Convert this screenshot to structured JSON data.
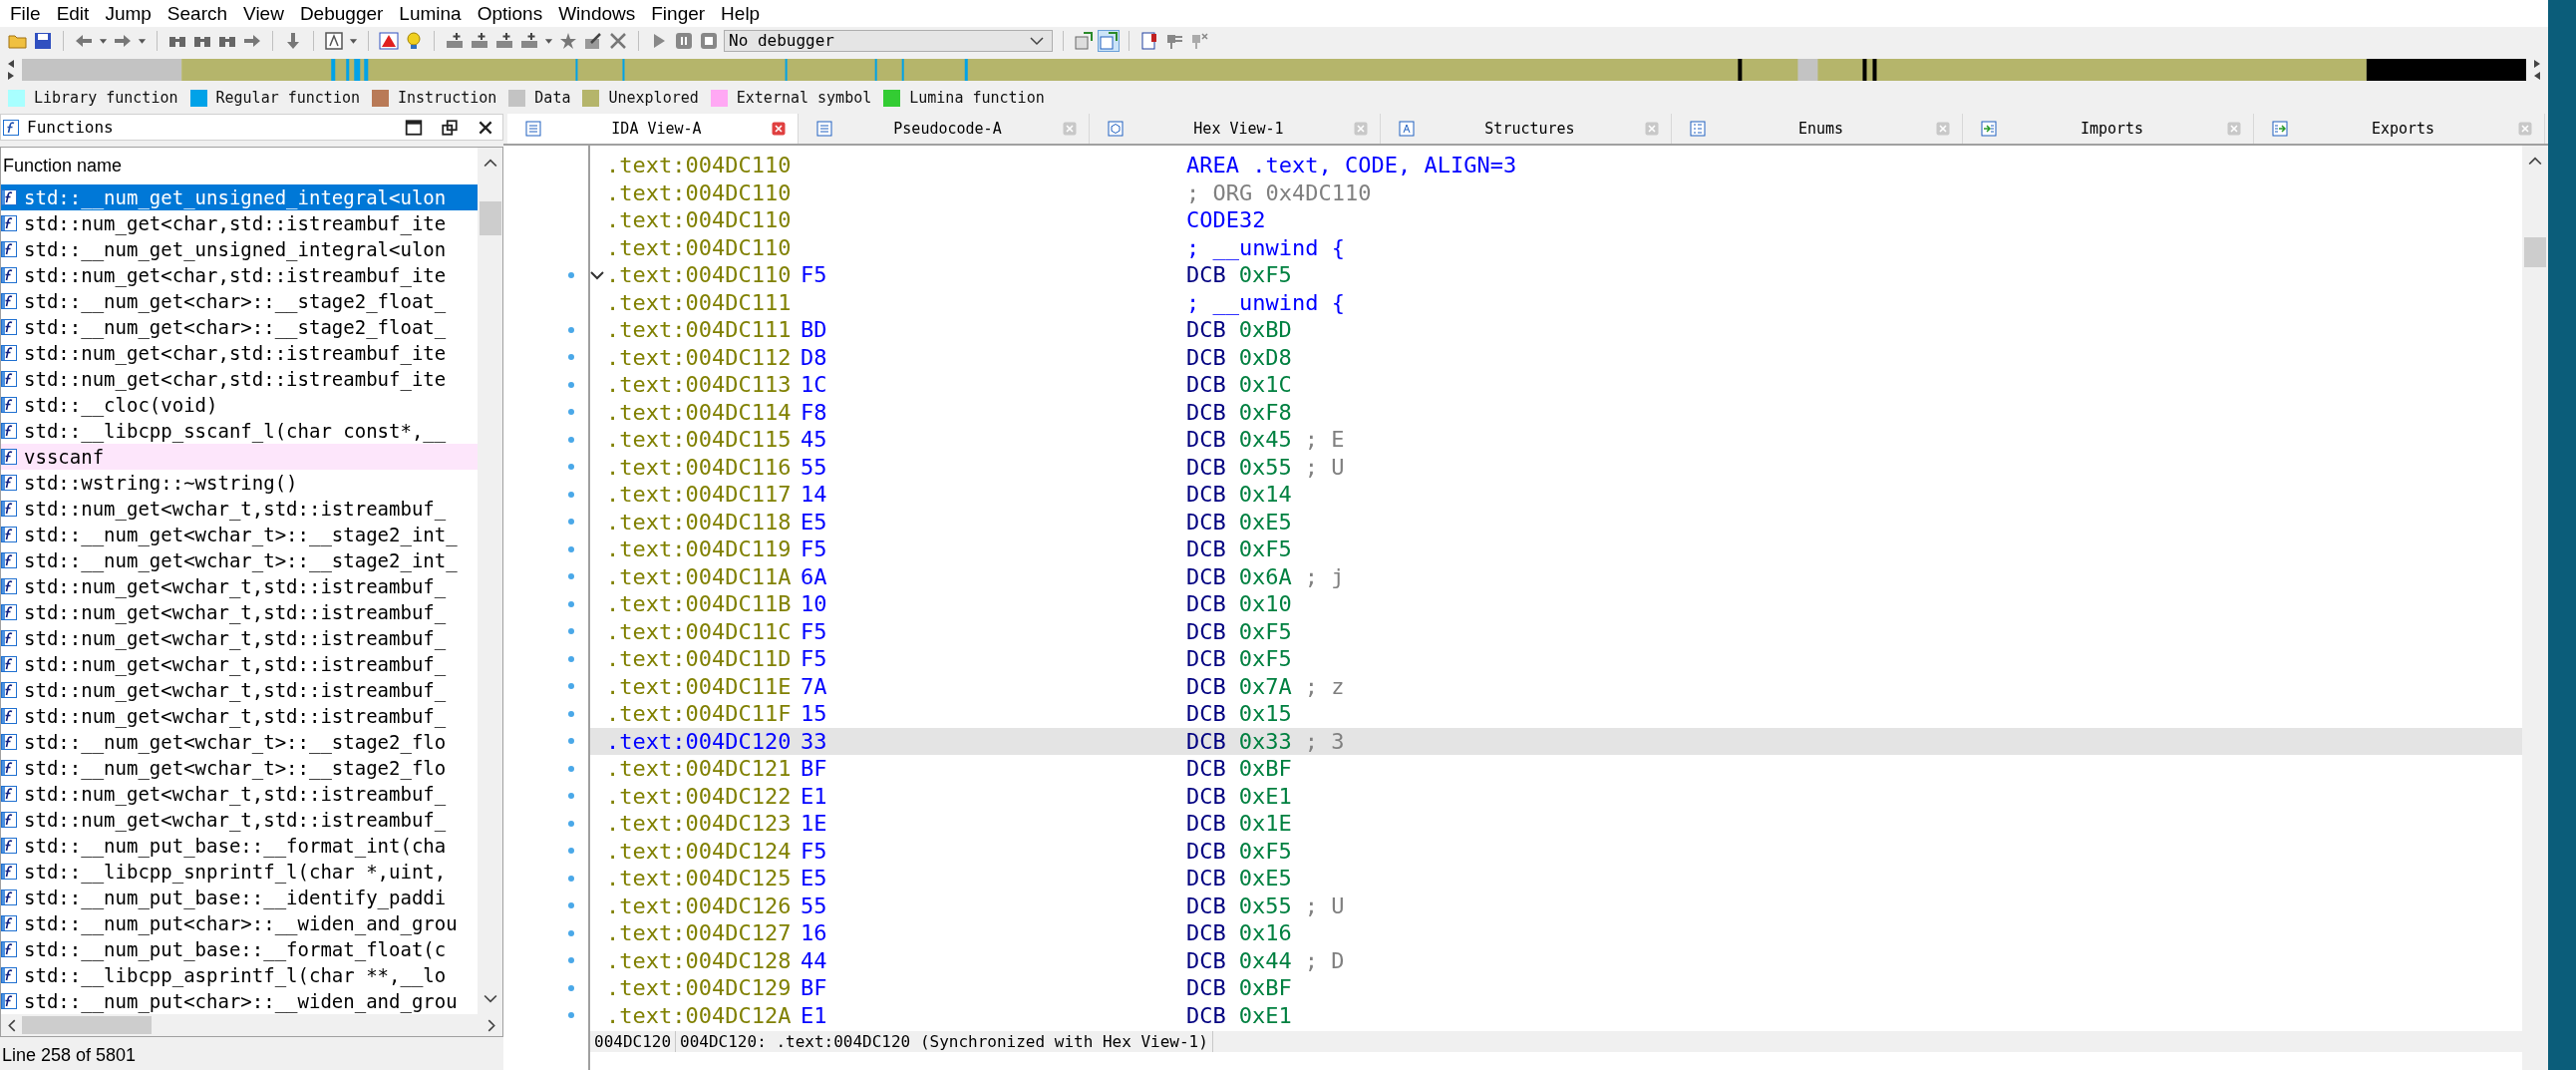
{
  "menu": [
    "File",
    "Edit",
    "Jump",
    "Search",
    "View",
    "Debugger",
    "Lumina",
    "Options",
    "Windows",
    "Finger",
    "Help"
  ],
  "toolbar": {
    "debugger": "No debugger"
  },
  "legend": [
    {
      "label": "Library function",
      "color": "#a8ffff"
    },
    {
      "label": "Regular function",
      "color": "#00a2e8"
    },
    {
      "label": "Instruction",
      "color": "#b97a57"
    },
    {
      "label": "Data",
      "color": "#c3c3c3"
    },
    {
      "label": "Unexplored",
      "color": "#b5b56b"
    },
    {
      "label": "External symbol",
      "color": "#ffa8f4"
    },
    {
      "label": "Lumina function",
      "color": "#33cc33"
    }
  ],
  "functions": {
    "title": "Functions",
    "column": "Function name",
    "status": "Line 258 of 5801",
    "rows": [
      {
        "name": "std::__num_get_unsigned_integral<ulon",
        "selected": true,
        "kind": "regular"
      },
      {
        "name": "std::num_get<char,std::istreambuf_ite",
        "selected": false,
        "kind": "regular"
      },
      {
        "name": "std::__num_get_unsigned_integral<ulon",
        "selected": false,
        "kind": "regular"
      },
      {
        "name": "std::num_get<char,std::istreambuf_ite",
        "selected": false,
        "kind": "regular"
      },
      {
        "name": "std::__num_get<char>::__stage2_float_",
        "selected": false,
        "kind": "regular"
      },
      {
        "name": "std::__num_get<char>::__stage2_float_",
        "selected": false,
        "kind": "regular"
      },
      {
        "name": "std::num_get<char,std::istreambuf_ite",
        "selected": false,
        "kind": "regular"
      },
      {
        "name": "std::num_get<char,std::istreambuf_ite",
        "selected": false,
        "kind": "regular"
      },
      {
        "name": "std::__cloc(void)",
        "selected": false,
        "kind": "regular"
      },
      {
        "name": "std::__libcpp_sscanf_l(char const*,__",
        "selected": false,
        "kind": "regular"
      },
      {
        "name": "vsscanf",
        "selected": false,
        "kind": "external"
      },
      {
        "name": "std::wstring::~wstring()",
        "selected": false,
        "kind": "regular"
      },
      {
        "name": "std::num_get<wchar_t,std::istreambuf_",
        "selected": false,
        "kind": "regular"
      },
      {
        "name": "std::__num_get<wchar_t>::__stage2_int_",
        "selected": false,
        "kind": "regular"
      },
      {
        "name": "std::__num_get<wchar_t>::__stage2_int_",
        "selected": false,
        "kind": "regular"
      },
      {
        "name": "std::num_get<wchar_t,std::istreambuf_",
        "selected": false,
        "kind": "regular"
      },
      {
        "name": "std::num_get<wchar_t,std::istreambuf_",
        "selected": false,
        "kind": "regular"
      },
      {
        "name": "std::num_get<wchar_t,std::istreambuf_",
        "selected": false,
        "kind": "regular"
      },
      {
        "name": "std::num_get<wchar_t,std::istreambuf_",
        "selected": false,
        "kind": "regular"
      },
      {
        "name": "std::num_get<wchar_t,std::istreambuf_",
        "selected": false,
        "kind": "regular"
      },
      {
        "name": "std::num_get<wchar_t,std::istreambuf_",
        "selected": false,
        "kind": "regular"
      },
      {
        "name": "std::__num_get<wchar_t>::__stage2_flo",
        "selected": false,
        "kind": "regular"
      },
      {
        "name": "std::__num_get<wchar_t>::__stage2_flo",
        "selected": false,
        "kind": "regular"
      },
      {
        "name": "std::num_get<wchar_t,std::istreambuf_",
        "selected": false,
        "kind": "regular"
      },
      {
        "name": "std::num_get<wchar_t,std::istreambuf_",
        "selected": false,
        "kind": "regular"
      },
      {
        "name": "std::__num_put_base::__format_int(cha",
        "selected": false,
        "kind": "regular"
      },
      {
        "name": "std::__libcpp_snprintf_l(char *,uint,",
        "selected": false,
        "kind": "regular"
      },
      {
        "name": "std::__num_put_base::__identify_paddi",
        "selected": false,
        "kind": "regular"
      },
      {
        "name": "std::__num_put<char>::__widen_and_grou",
        "selected": false,
        "kind": "regular"
      },
      {
        "name": "std::__num_put_base::__format_float(c",
        "selected": false,
        "kind": "regular"
      },
      {
        "name": "std::__libcpp_asprintf_l(char **,__lo",
        "selected": false,
        "kind": "regular"
      },
      {
        "name": "std::__num_put<char>::__widen_and_grou",
        "selected": false,
        "kind": "regular"
      }
    ]
  },
  "tabs": [
    {
      "label": "IDA View-A",
      "selected": true,
      "kind": "listing"
    },
    {
      "label": "Pseudocode-A",
      "selected": false,
      "kind": "listing"
    },
    {
      "label": "Hex View-1",
      "selected": false,
      "kind": "hex"
    },
    {
      "label": "Structures",
      "selected": false,
      "kind": "struct"
    },
    {
      "label": "Enums",
      "selected": false,
      "kind": "enum"
    },
    {
      "label": "Imports",
      "selected": false,
      "kind": "import"
    },
    {
      "label": "Exports",
      "selected": false,
      "kind": "export"
    }
  ],
  "listing": {
    "rows": [
      {
        "address": ".text:004DC110",
        "kind": "directive",
        "text": "AREA .text, CODE, ALIGN=3",
        "marker": false,
        "fold": false,
        "selected": false
      },
      {
        "address": ".text:004DC110",
        "kind": "comment",
        "text": "; ORG 0x4DC110",
        "marker": false,
        "fold": false,
        "selected": false
      },
      {
        "address": ".text:004DC110",
        "kind": "directive",
        "text": "CODE32",
        "marker": false,
        "fold": false,
        "selected": false
      },
      {
        "address": ".text:004DC110",
        "kind": "directive",
        "text": "; __unwind {",
        "marker": false,
        "fold": false,
        "selected": false
      },
      {
        "address": ".text:004DC110",
        "bytes": "F5",
        "kind": "data",
        "mnemonic": "DCB",
        "operand": "0xF5",
        "marker": true,
        "fold": true,
        "selected": false
      },
      {
        "address": ".text:004DC111",
        "kind": "directive",
        "text": "; __unwind {",
        "marker": false,
        "fold": false,
        "selected": false
      },
      {
        "address": ".text:004DC111",
        "bytes": "BD",
        "kind": "data",
        "mnemonic": "DCB",
        "operand": "0xBD",
        "marker": true,
        "fold": false,
        "selected": false
      },
      {
        "address": ".text:004DC112",
        "bytes": "D8",
        "kind": "data",
        "mnemonic": "DCB",
        "operand": "0xD8",
        "marker": true,
        "fold": false,
        "selected": false
      },
      {
        "address": ".text:004DC113",
        "bytes": "1C",
        "kind": "data",
        "mnemonic": "DCB",
        "operand": "0x1C",
        "marker": true,
        "fold": false,
        "selected": false
      },
      {
        "address": ".text:004DC114",
        "bytes": "F8",
        "kind": "data",
        "mnemonic": "DCB",
        "operand": "0xF8",
        "marker": true,
        "fold": false,
        "selected": false
      },
      {
        "address": ".text:004DC115",
        "bytes": "45",
        "kind": "data",
        "mnemonic": "DCB",
        "operand": "0x45",
        "comment": "; E",
        "marker": true,
        "fold": false,
        "selected": false
      },
      {
        "address": ".text:004DC116",
        "bytes": "55",
        "kind": "data",
        "mnemonic": "DCB",
        "operand": "0x55",
        "comment": "; U",
        "marker": true,
        "fold": false,
        "selected": false
      },
      {
        "address": ".text:004DC117",
        "bytes": "14",
        "kind": "data",
        "mnemonic": "DCB",
        "operand": "0x14",
        "marker": true,
        "fold": false,
        "selected": false
      },
      {
        "address": ".text:004DC118",
        "bytes": "E5",
        "kind": "data",
        "mnemonic": "DCB",
        "operand": "0xE5",
        "marker": true,
        "fold": false,
        "selected": false
      },
      {
        "address": ".text:004DC119",
        "bytes": "F5",
        "kind": "data",
        "mnemonic": "DCB",
        "operand": "0xF5",
        "marker": true,
        "fold": false,
        "selected": false
      },
      {
        "address": ".text:004DC11A",
        "bytes": "6A",
        "kind": "data",
        "mnemonic": "DCB",
        "operand": "0x6A",
        "comment": "; j",
        "marker": true,
        "fold": false,
        "selected": false
      },
      {
        "address": ".text:004DC11B",
        "bytes": "10",
        "kind": "data",
        "mnemonic": "DCB",
        "operand": "0x10",
        "marker": true,
        "fold": false,
        "selected": false
      },
      {
        "address": ".text:004DC11C",
        "bytes": "F5",
        "kind": "data",
        "mnemonic": "DCB",
        "operand": "0xF5",
        "marker": true,
        "fold": false,
        "selected": false
      },
      {
        "address": ".text:004DC11D",
        "bytes": "F5",
        "kind": "data",
        "mnemonic": "DCB",
        "operand": "0xF5",
        "marker": true,
        "fold": false,
        "selected": false
      },
      {
        "address": ".text:004DC11E",
        "bytes": "7A",
        "kind": "data",
        "mnemonic": "DCB",
        "operand": "0x7A",
        "comment": "; z",
        "marker": true,
        "fold": false,
        "selected": false
      },
      {
        "address": ".text:004DC11F",
        "bytes": "15",
        "kind": "data",
        "mnemonic": "DCB",
        "operand": "0x15",
        "marker": true,
        "fold": false,
        "selected": false
      },
      {
        "address": ".text:004DC120",
        "bytes": "33",
        "kind": "data",
        "mnemonic": "DCB",
        "operand": "0x33",
        "comment": "; 3",
        "marker": true,
        "fold": false,
        "selected": true
      },
      {
        "address": ".text:004DC121",
        "bytes": "BF",
        "kind": "data",
        "mnemonic": "DCB",
        "operand": "0xBF",
        "marker": true,
        "fold": false,
        "selected": false
      },
      {
        "address": ".text:004DC122",
        "bytes": "E1",
        "kind": "data",
        "mnemonic": "DCB",
        "operand": "0xE1",
        "marker": true,
        "fold": false,
        "selected": false
      },
      {
        "address": ".text:004DC123",
        "bytes": "1E",
        "kind": "data",
        "mnemonic": "DCB",
        "operand": "0x1E",
        "marker": true,
        "fold": false,
        "selected": false
      },
      {
        "address": ".text:004DC124",
        "bytes": "F5",
        "kind": "data",
        "mnemonic": "DCB",
        "operand": "0xF5",
        "marker": true,
        "fold": false,
        "selected": false
      },
      {
        "address": ".text:004DC125",
        "bytes": "E5",
        "kind": "data",
        "mnemonic": "DCB",
        "operand": "0xE5",
        "marker": true,
        "fold": false,
        "selected": false
      },
      {
        "address": ".text:004DC126",
        "bytes": "55",
        "kind": "data",
        "mnemonic": "DCB",
        "operand": "0x55",
        "comment": "; U",
        "marker": true,
        "fold": false,
        "selected": false
      },
      {
        "address": ".text:004DC127",
        "bytes": "16",
        "kind": "data",
        "mnemonic": "DCB",
        "operand": "0x16",
        "marker": true,
        "fold": false,
        "selected": false
      },
      {
        "address": ".text:004DC128",
        "bytes": "44",
        "kind": "data",
        "mnemonic": "DCB",
        "operand": "0x44",
        "comment": "; D",
        "marker": true,
        "fold": false,
        "selected": false
      },
      {
        "address": ".text:004DC129",
        "bytes": "BF",
        "kind": "data",
        "mnemonic": "DCB",
        "operand": "0xBF",
        "marker": true,
        "fold": false,
        "selected": false
      },
      {
        "address": ".text:004DC12A",
        "bytes": "E1",
        "kind": "data",
        "mnemonic": "DCB",
        "operand": "0xE1",
        "marker": true,
        "fold": false,
        "selected": false
      }
    ],
    "status": {
      "address": "004DC120",
      "location": "004DC120: .text:004DC120 (Synchronized with Hex View-1)"
    }
  }
}
